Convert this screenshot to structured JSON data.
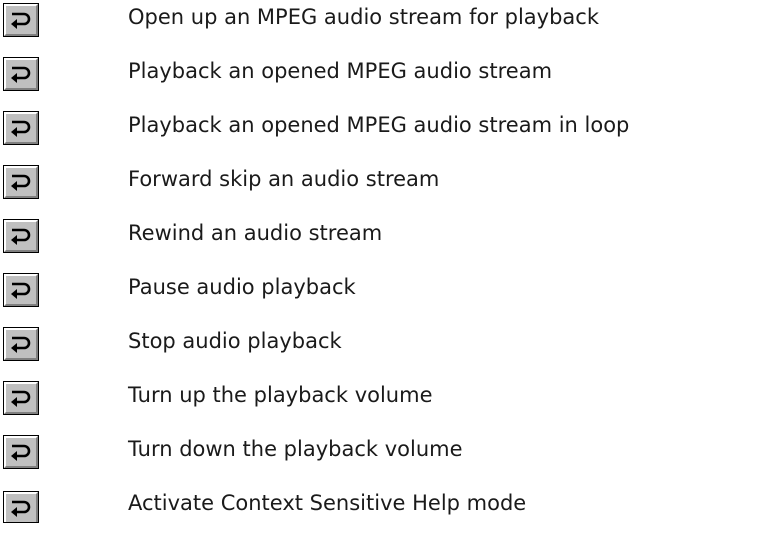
{
  "items": [
    {
      "label": "Open up an MPEG audio stream for playback",
      "icon": "jump-arrow-icon"
    },
    {
      "label": "Playback an opened MPEG audio stream",
      "icon": "jump-arrow-icon"
    },
    {
      "label": "Playback an opened MPEG audio stream in loop",
      "icon": "jump-arrow-icon"
    },
    {
      "label": "Forward skip an audio stream",
      "icon": "jump-arrow-icon"
    },
    {
      "label": "Rewind an audio stream",
      "icon": "jump-arrow-icon"
    },
    {
      "label": "Pause audio playback",
      "icon": "jump-arrow-icon"
    },
    {
      "label": "Stop audio playback",
      "icon": "jump-arrow-icon"
    },
    {
      "label": "Turn up the playback volume",
      "icon": "jump-arrow-icon"
    },
    {
      "label": "Turn down the playback volume",
      "icon": "jump-arrow-icon"
    },
    {
      "label": "Activate Context Sensitive Help mode",
      "icon": "jump-arrow-icon"
    }
  ],
  "colors": {
    "button_face": "#c0c0c0",
    "icon": "#000000",
    "text": "#1a1a1a",
    "background": "#ffffff"
  }
}
